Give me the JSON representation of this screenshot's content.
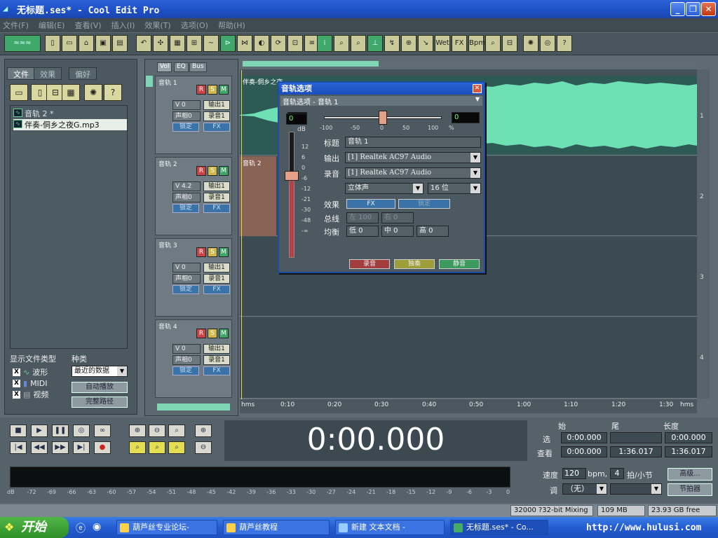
{
  "window": {
    "title": "无标题.ses* - Cool Edit Pro"
  },
  "menu": [
    "文件(F)",
    "编辑(E)",
    "查看(V)",
    "插入(I)",
    "效果(T)",
    "选项(O)",
    "帮助(H)"
  ],
  "left_panel": {
    "tabs": [
      "文件",
      "效果",
      "偏好"
    ],
    "files": [
      {
        "name": "音轨 2 *"
      },
      {
        "name": "伴奏-侗乡之夜G.mp3"
      }
    ],
    "show_types_label": "显示文件类型",
    "types": [
      "波形",
      "MIDI",
      "视频"
    ],
    "sort_label": "种类",
    "sort_value": "最近的数据",
    "auto_play_btn": "自动播放",
    "full_path_btn": "完整路径"
  },
  "track_panel": {
    "tabs": [
      "Vol",
      "EQ",
      "Bus"
    ],
    "tracks": [
      {
        "name": "音轨 1",
        "vol": "V 0",
        "pan": "声相0",
        "out": "输出1",
        "rec": "录音1",
        "lock": "锁定",
        "fx": "FX"
      },
      {
        "name": "音轨 2",
        "vol": "V 4.2",
        "pan": "声相0",
        "out": "输出1",
        "rec": "录音1",
        "lock": "锁定",
        "fx": "FX"
      },
      {
        "name": "音轨 3",
        "vol": "V 0",
        "pan": "声相0",
        "out": "输出1",
        "rec": "录音1",
        "lock": "锁定",
        "fx": "FX"
      },
      {
        "name": "音轨 4",
        "vol": "V 0",
        "pan": "声相0",
        "out": "输出1",
        "rec": "录音1",
        "lock": "锁定",
        "fx": "FX"
      }
    ]
  },
  "wave": {
    "clip1": "伴奏-侗乡之夜",
    "clip2": "音轨 2",
    "ruler": [
      "hms",
      "0:10",
      "0:20",
      "0:30",
      "0:40",
      "0:50",
      "1:00",
      "1:10",
      "1:20",
      "1:30",
      "hms"
    ],
    "track_numbers": [
      "1",
      "2",
      "3",
      "4"
    ]
  },
  "dialog": {
    "title": "音轨选项",
    "subtitle": "音轨选项 - 音轨 1",
    "pan_left_value": "0",
    "pan_right_value": "0",
    "pan_scale": [
      "-100",
      "-50",
      "0",
      "50",
      "100",
      "%"
    ],
    "vol_value": "0",
    "db_label": "dB",
    "db_scale": [
      "12",
      "6",
      "0",
      "-6",
      "-12",
      "-21",
      "-30",
      "-48",
      "-∞"
    ],
    "title_label": "标题",
    "title_value": "音轨 1",
    "output_label": "输出",
    "output_value": "[1] Realtek AC97 Audio",
    "record_label": "录音",
    "record_value": "[1] Realtek AC97 Audio",
    "channel_value": "立体声",
    "bits_value": "16 位",
    "effects_label": "效果",
    "fx_button": "FX",
    "lock_button": "锁定",
    "bus_label": "总线",
    "bus_left": "左 100",
    "bus_right": "右 0",
    "eq_label": "均衡",
    "eq_low": "低 0",
    "eq_mid": "中 0",
    "eq_high": "高 0",
    "btn_record": "录音",
    "btn_solo": "独奏",
    "btn_mute": "静音",
    "fader_level": 0.62
  },
  "transport": {
    "time": "0:00.000",
    "headers": [
      "始",
      "尾",
      "长度"
    ],
    "sel_label": "选",
    "view_label": "查看",
    "sel_start": "0:00.000",
    "sel_end": "",
    "sel_len": "0:00.000",
    "view_start": "0:00.000",
    "view_end": "1:36.017",
    "view_len": "1:36.017",
    "tempo_label": "速度",
    "tempo_value": "120",
    "bpm_label": "bpm,",
    "beats_value": "4",
    "beats_label": "拍/小节",
    "key_label": "调",
    "key_value": "（无）",
    "advanced_btn": "高级...",
    "metronome_btn": "节拍器"
  },
  "meter_scale": [
    "dB",
    "-72",
    "-69",
    "-66",
    "-63",
    "-60",
    "-57",
    "-54",
    "-51",
    "-48",
    "-45",
    "-42",
    "-39",
    "-36",
    "-33",
    "-30",
    "-27",
    "-24",
    "-21",
    "-18",
    "-15",
    "-12",
    "-9",
    "-6",
    "-3",
    "0"
  ],
  "status": {
    "mixing": "32000 ?32-bit Mixing",
    "memory": "109 MB",
    "disk": "23.93 GB free"
  },
  "taskbar": {
    "start": "开始",
    "tasks": [
      "葫芦丝专业论坛-",
      "葫芦丝教程",
      "新建 文本文档 -",
      "无标题.ses* - Co..."
    ],
    "url": "http://www.hulusi.com"
  },
  "colors": {
    "title_blue": "#1d4fc4",
    "wave_green": "#6ee0b4",
    "record_red": "#c94444",
    "mute_green": "#3fa66a"
  }
}
